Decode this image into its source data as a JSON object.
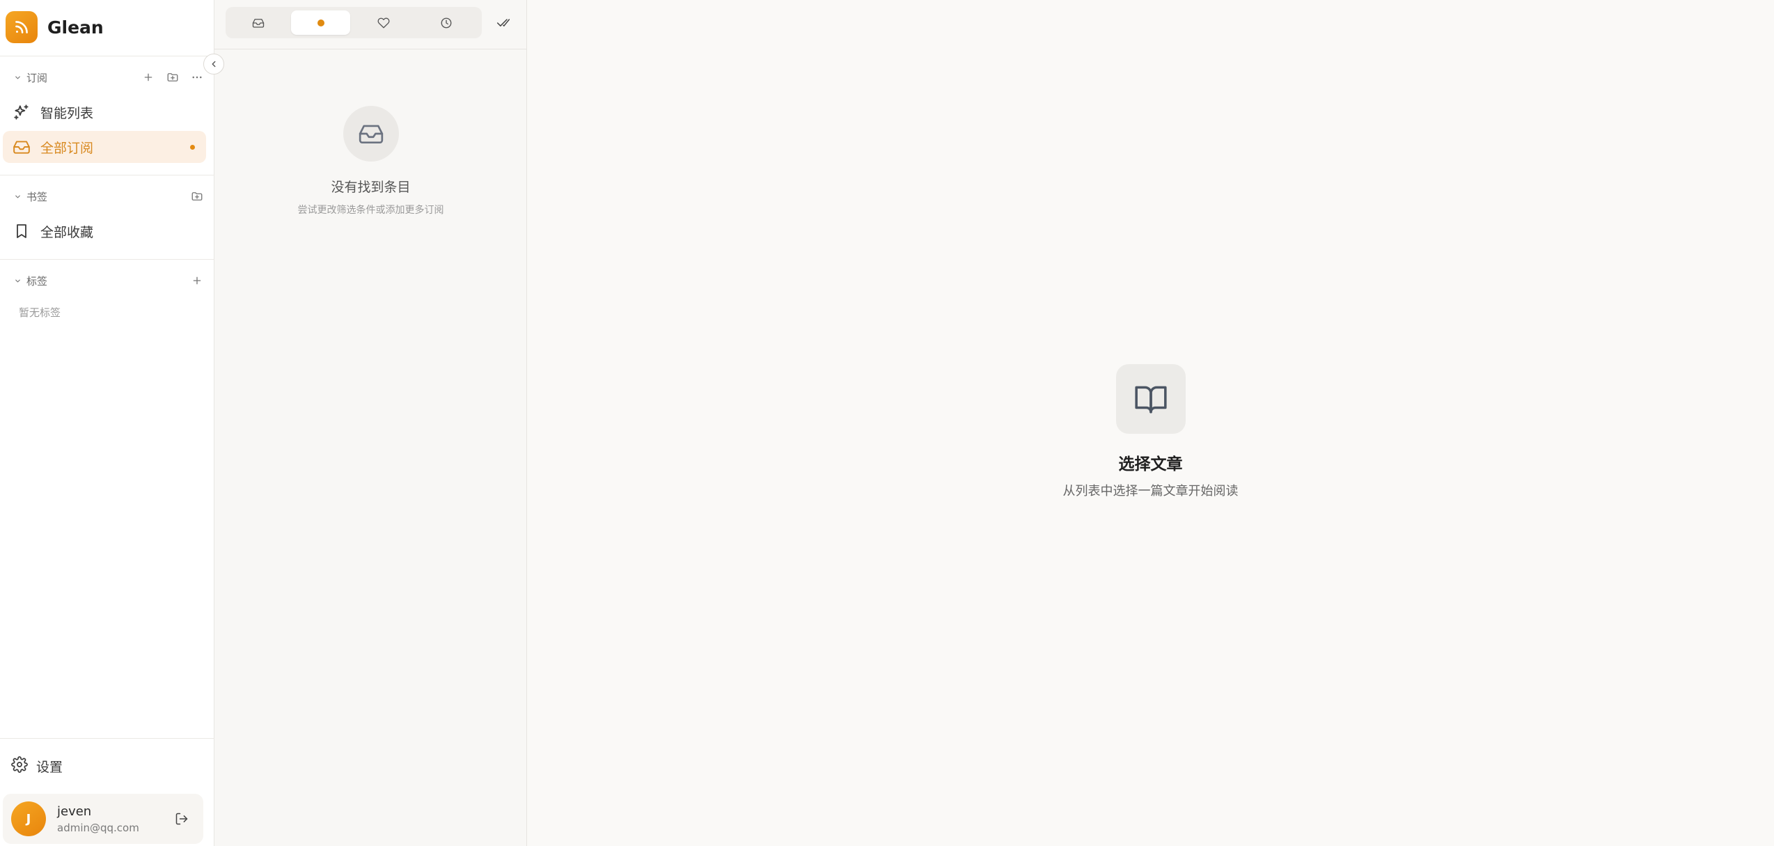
{
  "app": {
    "name": "Glean"
  },
  "sidebar": {
    "subscriptions": {
      "label": "订阅",
      "items": [
        {
          "label": "智能列表",
          "icon": "sparkles-icon"
        },
        {
          "label": "全部订阅",
          "icon": "inbox-icon",
          "active": true,
          "unread": true
        }
      ]
    },
    "bookmarks": {
      "label": "书签",
      "items": [
        {
          "label": "全部收藏",
          "icon": "bookmark-icon"
        }
      ]
    },
    "tags": {
      "label": "标签",
      "empty_text": "暂无标签"
    },
    "settings_label": "设置",
    "user": {
      "initial": "J",
      "name": "jeven",
      "email": "admin@qq.com"
    }
  },
  "list": {
    "filters": [
      {
        "icon": "inbox-icon"
      },
      {
        "icon": "unread-dot-icon",
        "active": true
      },
      {
        "icon": "heart-icon"
      },
      {
        "icon": "clock-icon"
      }
    ],
    "empty": {
      "title": "没有找到条目",
      "subtitle": "尝试更改筛选条件或添加更多订阅"
    }
  },
  "reader": {
    "empty": {
      "title": "选择文章",
      "subtitle": "从列表中选择一篇文章开始阅读"
    }
  },
  "colors": {
    "accent": "#e8850c",
    "active_bg": "#fcefe3",
    "active_text": "#d8891f"
  }
}
